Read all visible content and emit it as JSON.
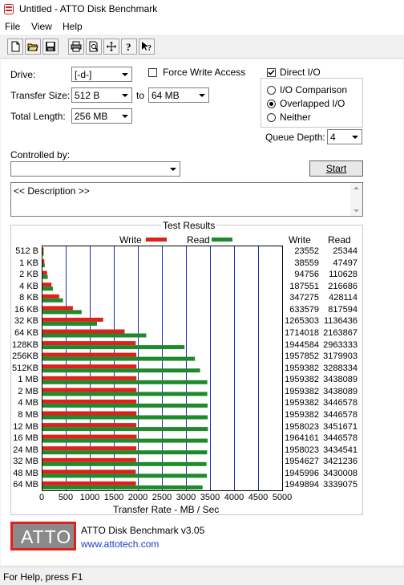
{
  "window": {
    "title": "Untitled - ATTO Disk Benchmark"
  },
  "menu": {
    "items": [
      "File",
      "View",
      "Help"
    ]
  },
  "toolbar": {
    "icons": [
      "new-icon",
      "open-icon",
      "save-icon",
      "print-icon",
      "print-preview-icon",
      "move-icon",
      "help-icon",
      "context-help-icon"
    ]
  },
  "settings": {
    "drive_label": "Drive:",
    "drive_value": "[-d-]",
    "force_write_label": "Force Write Access",
    "force_write_checked": false,
    "direct_io_label": "Direct I/O",
    "direct_io_checked": true,
    "transfer_label": "Transfer Size:",
    "transfer_from": "512 B",
    "to_label": "to",
    "transfer_to": "64 MB",
    "total_length_label": "Total Length:",
    "total_length_value": "256 MB",
    "io_comparison_label": "I/O Comparison",
    "overlapped_label": "Overlapped I/O",
    "neither_label": "Neither",
    "selected_mode": "Overlapped I/O",
    "queue_depth_label": "Queue Depth:",
    "queue_depth_value": "4",
    "controlled_by_label": "Controlled by:",
    "controlled_by_value": "",
    "start_label": "Start",
    "description_text": "<< Description >>"
  },
  "results": {
    "group_title": "Test Results",
    "write_col": "Write",
    "read_col": "Read"
  },
  "chart_data": {
    "type": "bar",
    "orientation": "horizontal",
    "xlabel": "Transfer Rate - MB / Sec",
    "xlim": [
      0,
      5000
    ],
    "xticks": [
      "0",
      "500",
      "1000",
      "1500",
      "2000",
      "2500",
      "3000",
      "3500",
      "4000",
      "4500",
      "5000"
    ],
    "categories": [
      "512 B",
      "1 KB",
      "2 KB",
      "4 KB",
      "8 KB",
      "16 KB",
      "32 KB",
      "64 KB",
      "128KB",
      "256KB",
      "512KB",
      "1 MB",
      "2 MB",
      "4 MB",
      "8 MB",
      "12 MB",
      "16 MB",
      "24 MB",
      "32 MB",
      "48 MB",
      "64 MB"
    ],
    "series": [
      {
        "name": "Write",
        "color": "#e0201a",
        "values": [
          23552,
          38559,
          94756,
          187551,
          347275,
          633579,
          1265303,
          1714018,
          1944584,
          1957852,
          1959382,
          1959382,
          1959382,
          1959382,
          1959382,
          1958023,
          1964161,
          1958023,
          1954627,
          1945996,
          1949894
        ]
      },
      {
        "name": "Read",
        "color": "#1f8a2b",
        "values": [
          25344,
          47497,
          110628,
          216686,
          428114,
          817594,
          1136436,
          2163867,
          2963333,
          3179903,
          3288334,
          3438089,
          3438089,
          3446578,
          3446578,
          3451671,
          3446578,
          3434541,
          3421236,
          3430008,
          3339075
        ]
      }
    ],
    "grid": true,
    "legend": "top"
  },
  "footer": {
    "logo_text": "ATTO",
    "product": "ATTO Disk Benchmark v3.05",
    "link": "www.attotech.com"
  },
  "status": {
    "text": "For Help, press F1"
  }
}
